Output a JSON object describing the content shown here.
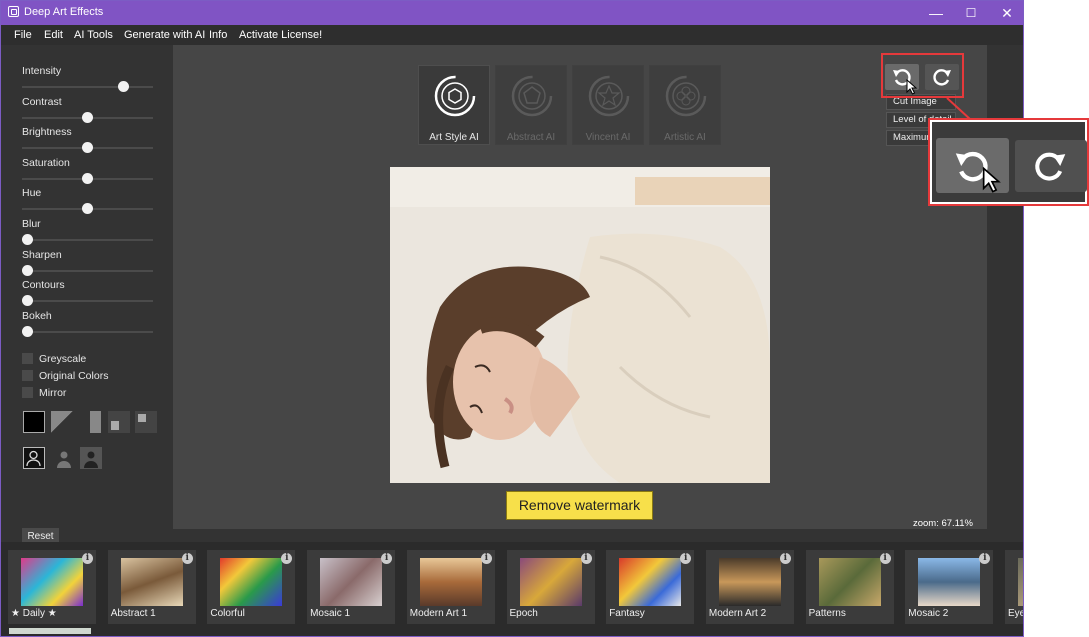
{
  "window": {
    "title": "Deep Art Effects",
    "minimize": "—",
    "maximize": "☐",
    "close": "✕"
  },
  "menu": [
    "File",
    "Edit",
    "AI Tools",
    "Generate with AI",
    "Info",
    "Activate License!"
  ],
  "sliders": [
    {
      "label": "Intensity",
      "value": 0.8
    },
    {
      "label": "Contrast",
      "value": 0.5
    },
    {
      "label": "Brightness",
      "value": 0.5
    },
    {
      "label": "Saturation",
      "value": 0.5
    },
    {
      "label": "Hue",
      "value": 0.5
    },
    {
      "label": "Blur",
      "value": 0.0
    },
    {
      "label": "Sharpen",
      "value": 0.0
    },
    {
      "label": "Contours",
      "value": 0.0
    },
    {
      "label": "Bokeh",
      "value": 0.0
    }
  ],
  "checkboxes": [
    "Greyscale",
    "Original Colors",
    "Mirror"
  ],
  "reset_label": "Reset",
  "style_buttons": [
    "Art Style AI",
    "Abstract AI",
    "Vincent AI",
    "Artistic AI"
  ],
  "context_menu": [
    "Cut Image",
    "Level of detail",
    "Maximum"
  ],
  "watermark_label": "Remove watermark",
  "zoom": "zoom: 67.11%",
  "gallery": [
    "★ Daily ★",
    "Abstract 1",
    "Colorful",
    "Mosaic 1",
    "Modern Art 1",
    "Epoch",
    "Fantasy",
    "Modern Art 2",
    "Patterns",
    "Mosaic 2",
    "Eye"
  ],
  "info_glyph": "i",
  "colors": {
    "accent": "#8054c4",
    "highlight": "#e5393b",
    "watermark": "#f7e04a"
  }
}
